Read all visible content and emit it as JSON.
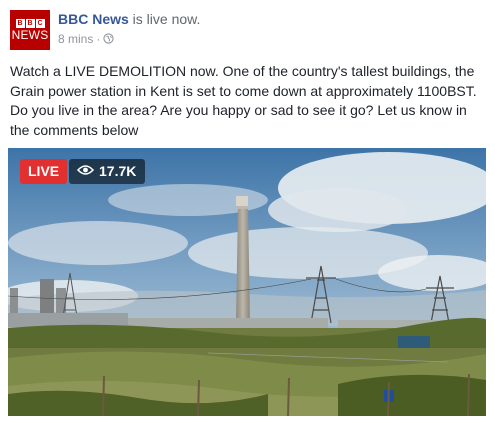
{
  "post": {
    "avatar": {
      "logo_letters": [
        "B",
        "B",
        "C"
      ],
      "logo_word": "NEWS",
      "icon": "bbc-news-logo"
    },
    "page_name": "BBC News",
    "status": " is live now.",
    "time": "8 mins",
    "separator": "·",
    "privacy_icon": "globe-icon",
    "text": "Watch a LIVE DEMOLITION now. One of the country's tallest buildings, the Grain power station in Kent is set to come down at approximately 1100BST. Do you live in the area? Are you happy or sad to see it go? Let us know in the comments below"
  },
  "video": {
    "live_label": "LIVE",
    "viewer_icon": "eye-icon",
    "viewers": "17.7K"
  },
  "colors": {
    "brand_red": "#b80000",
    "live_red": "#e22f2f",
    "link_blue": "#365899"
  }
}
